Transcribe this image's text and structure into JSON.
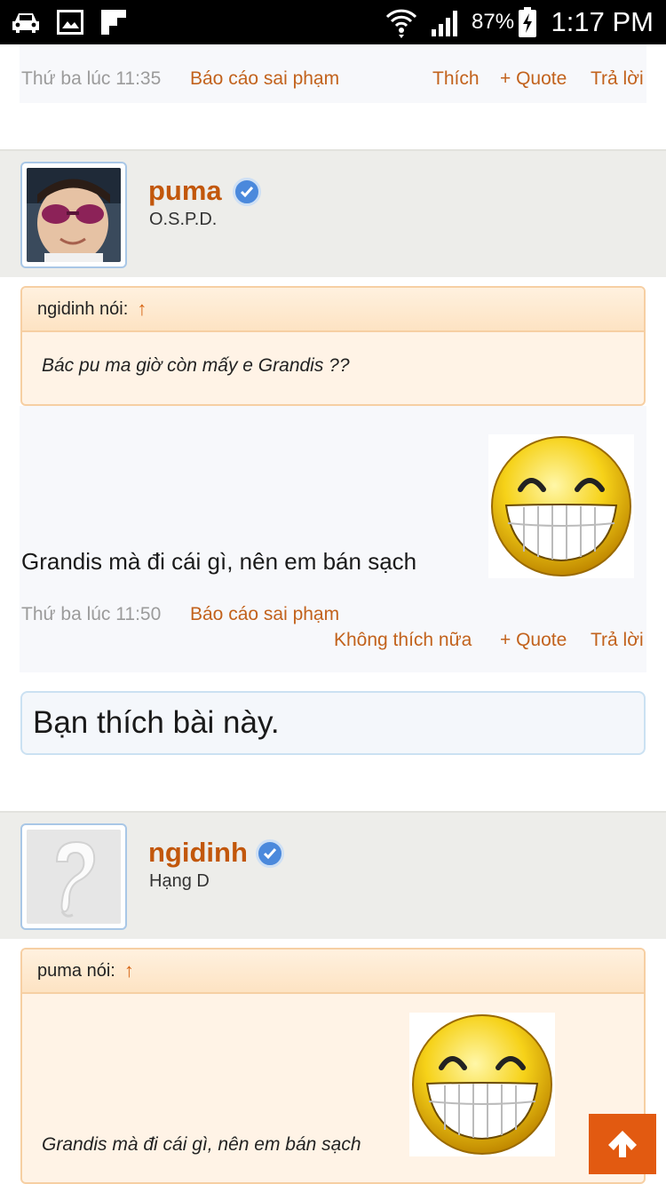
{
  "status_bar": {
    "battery_percent": "87%",
    "time": "1:17 PM"
  },
  "post1": {
    "timestamp": "Thứ ba lúc 11:35",
    "report_label": "Báo cáo sai phạm",
    "like_label": "Thích",
    "quote_label": "+ Quote",
    "reply_label": "Trả lời"
  },
  "post2": {
    "username": "puma",
    "user_title": "O.S.P.D.",
    "quote": {
      "author_label": "ngidinh nói:",
      "arrow": "↑",
      "text": "Bác pu ma giờ còn mấy e Grandis ??"
    },
    "message": "Grandis mà đi cái gì, nên em bán sạch",
    "smiley_icon": "big-grin-smiley",
    "timestamp": "Thứ ba lúc 11:50",
    "report_label": "Báo cáo sai phạm",
    "unlike_label": "Không thích nữa",
    "quote_label": "+ Quote",
    "reply_label": "Trả lời",
    "liked_notice": "Bạn thích bài này."
  },
  "post3": {
    "username": "ngidinh",
    "user_title": "Hạng D",
    "quote": {
      "author_label": "puma nói:",
      "arrow": "↑",
      "text": "Grandis mà đi cái gì, nên em bán sạch"
    },
    "smiley_icon": "big-grin-smiley"
  },
  "colors": {
    "link": "#c2621c",
    "username": "#c2570b",
    "quote_border": "#f6cfa3",
    "scroll_top_button": "#e25a11",
    "verified_badge": "#4b89dc"
  }
}
